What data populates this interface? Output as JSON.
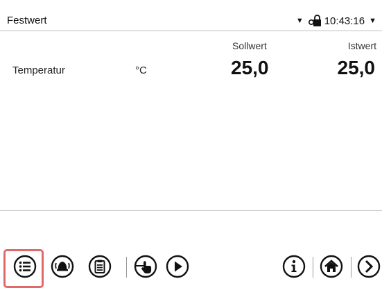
{
  "header": {
    "title": "Festwert",
    "time": "10:43:16",
    "icons": [
      "dropdown-triangle-icon",
      "lock-icon",
      "dropdown-triangle-icon"
    ]
  },
  "table": {
    "columns": [
      "Sollwert",
      "Istwert"
    ],
    "rows": [
      {
        "label": "Temperatur",
        "unit": "°C",
        "sollwert": "25,0",
        "istwert": "25,0"
      }
    ]
  },
  "footer": {
    "buttons": [
      "menu-icon",
      "alarm-bell-icon",
      "clipboard-icon",
      "touch-hand-icon",
      "play-icon",
      "info-icon",
      "home-icon",
      "next-arrow-icon"
    ],
    "highlighted": "menu-icon",
    "highlight_color": "#e06a6a"
  }
}
